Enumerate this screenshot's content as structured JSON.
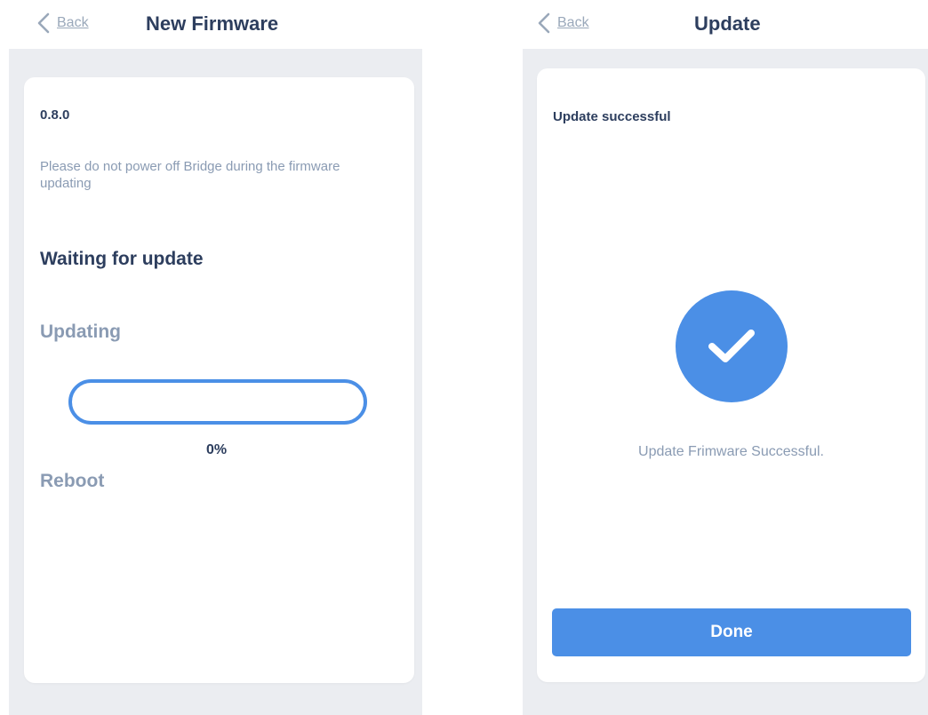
{
  "left_screen": {
    "nav": {
      "back_label": "Back",
      "title": "New Firmware"
    },
    "card": {
      "version": "0.8.0",
      "warning": "Please do not power off Bridge during the firmware updating",
      "steps": {
        "waiting": "Waiting for update",
        "updating": "Updating",
        "reboot": "Reboot"
      },
      "progress": {
        "value": 0,
        "label": "0%"
      }
    }
  },
  "right_screen": {
    "nav": {
      "back_label": "Back",
      "title": "Update"
    },
    "card": {
      "heading": "Update successful",
      "icon": "checkmark-icon",
      "message": "Update Frimware Successful.",
      "done_label": "Done"
    }
  },
  "colors": {
    "accent": "#4b8fe6",
    "title_text": "#2d3e5e",
    "muted_text": "#8a9bb3",
    "background": "#ebedf1",
    "card": "#ffffff"
  }
}
